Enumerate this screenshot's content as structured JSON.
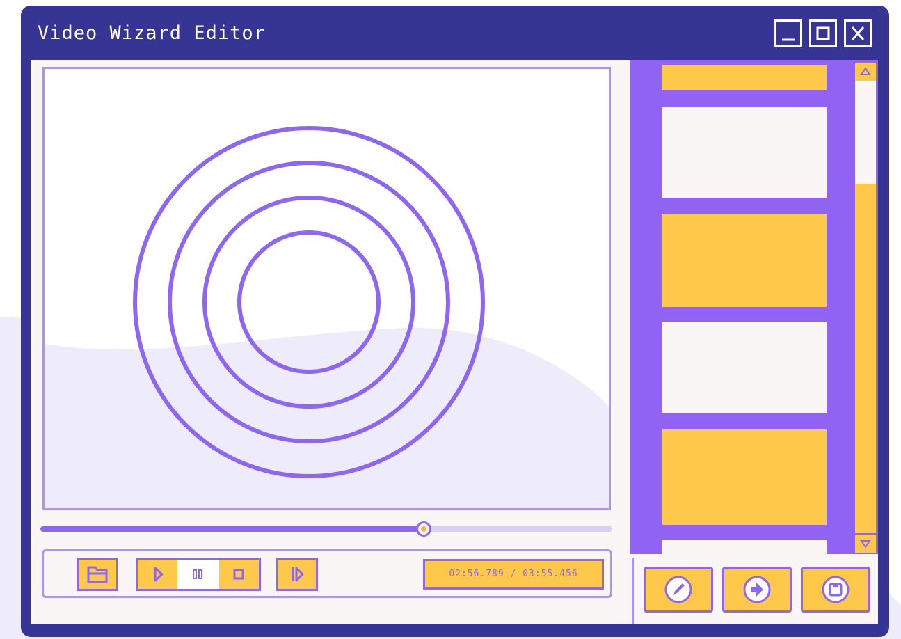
{
  "app": {
    "title": "Video Wizard Editor",
    "window_controls": {
      "minimize_icon": "minimize-icon",
      "maximize_icon": "maximize-icon",
      "close_icon": "close-icon"
    }
  },
  "player": {
    "progress": 0.67,
    "time_display": "02:56.789 / 03:55.456",
    "controls": {
      "open_icon": "folder-icon",
      "play_icon": "play-icon",
      "pause_icon": "pause-icon",
      "stop_icon": "stop-icon",
      "next_frame_icon": "next-frame-icon",
      "active": "pause"
    }
  },
  "sidebar": {
    "thumbnails": [
      "yellow",
      "white",
      "yellow",
      "white",
      "yellow",
      "white"
    ],
    "scroll": {
      "up_icon": "scroll-up-icon",
      "down_icon": "scroll-down-icon",
      "position": 0.0
    }
  },
  "actions": {
    "edit_icon": "pencil-icon",
    "export_icon": "arrow-right-icon",
    "save_icon": "save-icon"
  },
  "colors": {
    "window": "#373593",
    "accent": "#9063f2",
    "yellow": "#fec84b",
    "panel": "#fbf6f6"
  }
}
